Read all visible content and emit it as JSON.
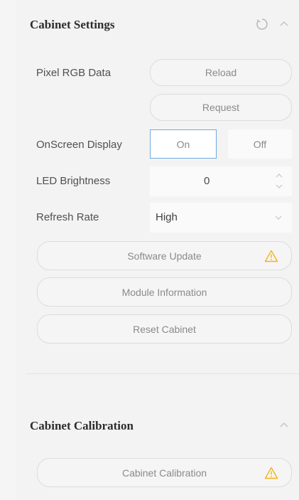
{
  "settings": {
    "title": "Cabinet Settings",
    "pixel_rgb_label": "Pixel RGB Data",
    "reload_label": "Reload",
    "request_label": "Request",
    "osd_label": "OnScreen Display",
    "osd_on": "On",
    "osd_off": "Off",
    "osd_selected": "On",
    "brightness_label": "LED Brightness",
    "brightness_value": "0",
    "refresh_label": "Refresh Rate",
    "refresh_value": "High",
    "software_update_label": "Software Update",
    "module_info_label": "Module Information",
    "reset_label": "Reset Cabinet"
  },
  "calibration": {
    "title": "Cabinet Calibration",
    "button_label": "Cabinet Calibration"
  },
  "icons": {
    "refresh": "refresh-icon",
    "collapse": "chevron-up-icon",
    "spin_up": "chevron-up-icon",
    "spin_down": "chevron-down-icon",
    "dropdown": "chevron-down-icon",
    "warning": "warning-icon"
  },
  "colors": {
    "warning": "#f2b21b",
    "selected_border": "#6fa8dc"
  }
}
